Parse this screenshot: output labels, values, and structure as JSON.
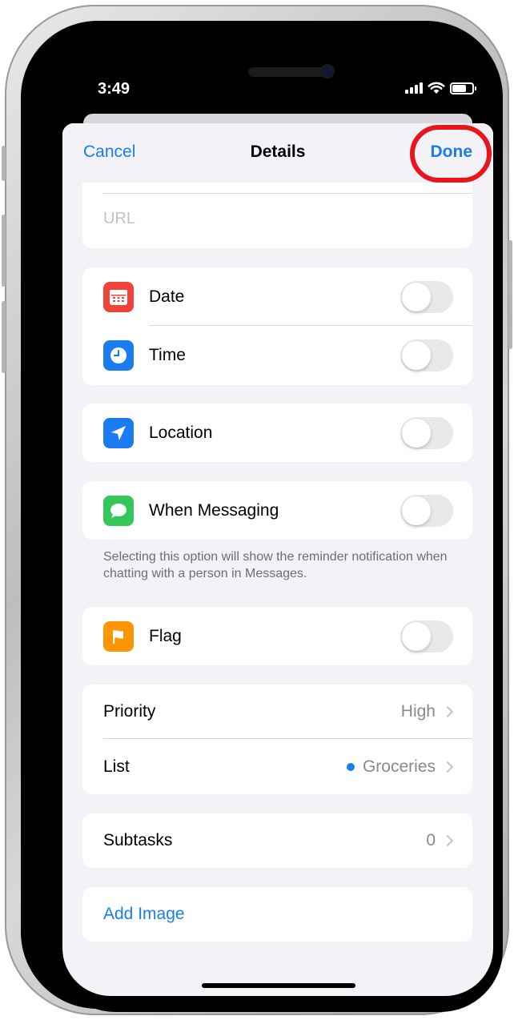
{
  "status_bar": {
    "time": "3:49"
  },
  "nav": {
    "cancel": "Cancel",
    "title": "Details",
    "done": "Done"
  },
  "url": {
    "placeholder": "URL"
  },
  "rows": {
    "date": "Date",
    "time": "Time",
    "location": "Location",
    "messaging": "When Messaging",
    "flag": "Flag"
  },
  "toggles": {
    "date": false,
    "time": false,
    "location": false,
    "messaging": false,
    "flag": false
  },
  "messaging_note": "Selecting this option will show the reminder notification when chatting with a person in Messages.",
  "priority": {
    "label": "Priority",
    "value": "High"
  },
  "list": {
    "label": "List",
    "value": "Groceries"
  },
  "subtasks": {
    "label": "Subtasks",
    "value": "0"
  },
  "add_image": "Add Image",
  "colors": {
    "accent": "#1a7cf0",
    "date_icon": "#f2433a",
    "time_icon": "#1a7cf0",
    "location_icon": "#1a7cf0",
    "messaging_icon": "#34c759",
    "flag_icon": "#ff9500",
    "highlight_ring": "#e8141e"
  },
  "icons": {
    "date": "calendar-icon",
    "time": "clock-icon",
    "location": "location-arrow-icon",
    "messaging": "message-bubble-icon",
    "flag": "flag-icon"
  }
}
